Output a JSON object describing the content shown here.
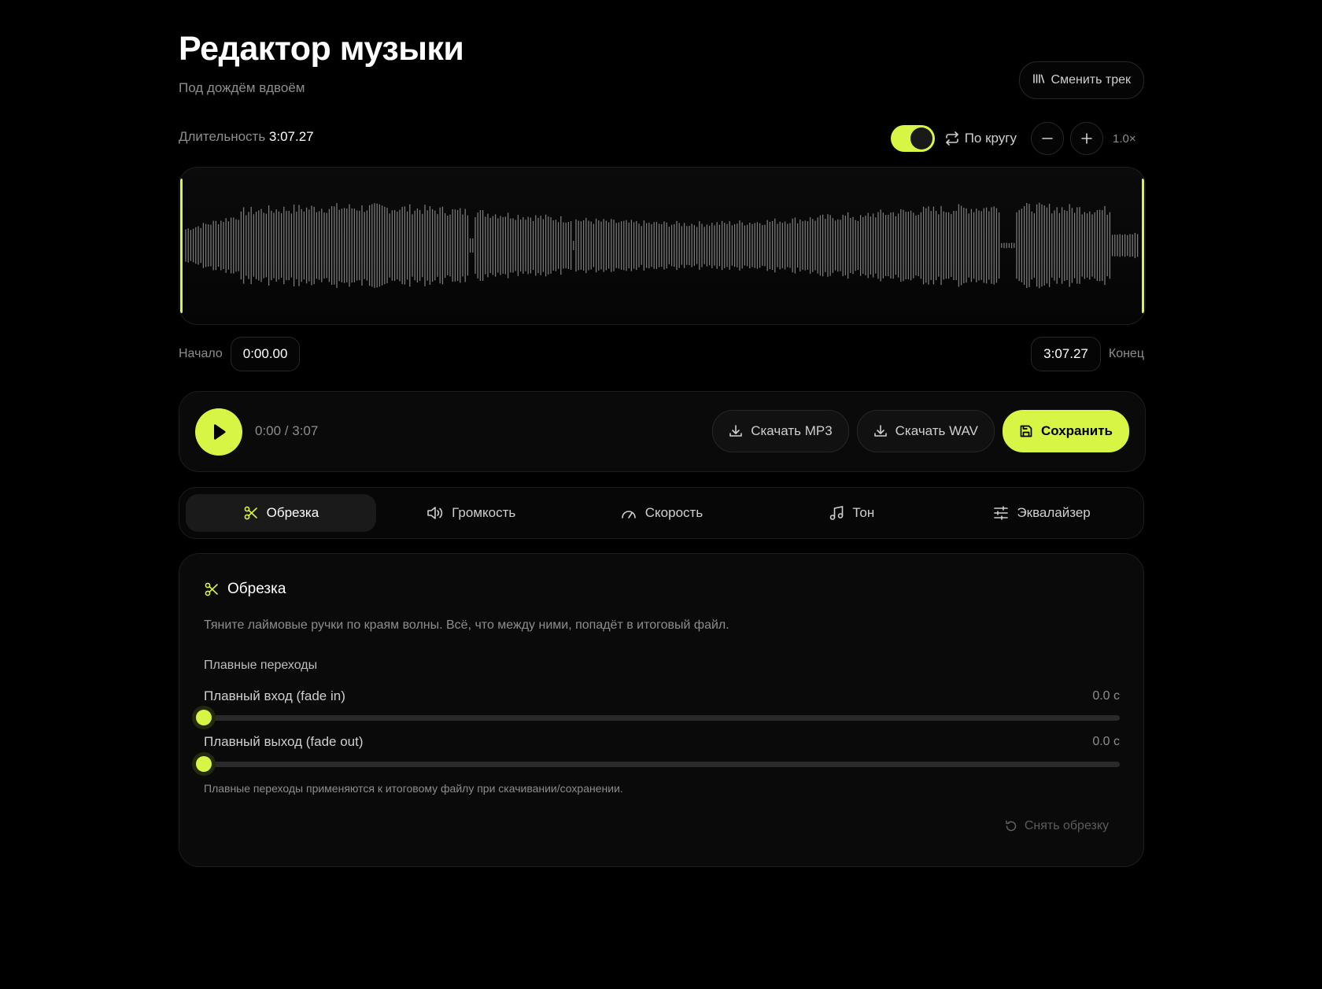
{
  "header": {
    "title": "Редактор музыки",
    "subtitle": "Под дождём вдвоём",
    "switch_track_label": "Сменить трек"
  },
  "meta": {
    "duration_label": "Длительность",
    "duration_value": "3:07.27"
  },
  "loop": {
    "enabled": true,
    "label": "По кругу"
  },
  "zoom": {
    "out_symbol": "−",
    "in_symbol": "+",
    "level": "1.0×"
  },
  "waveform": {
    "trim_start_fraction": 0,
    "trim_end_fraction": 1
  },
  "trim": {
    "start_label": "Начало",
    "start_value": "0:00.00",
    "end_value": "3:07.27",
    "end_label": "Конец"
  },
  "player": {
    "progress": "0:00 / 3:07",
    "download_mp3": "Скачать MP3",
    "download_wav": "Скачать WAV",
    "save": "Сохранить"
  },
  "tabs": [
    {
      "label": "Обрезка",
      "icon": "scissors-icon",
      "active": true
    },
    {
      "label": "Громкость",
      "icon": "volume-icon",
      "active": false
    },
    {
      "label": "Скорость",
      "icon": "speedometer-icon",
      "active": false
    },
    {
      "label": "Тон",
      "icon": "music-note-icon",
      "active": false
    },
    {
      "label": "Эквалайзер",
      "icon": "equalizer-icon",
      "active": false
    }
  ],
  "panel": {
    "title": "Обрезка",
    "description": "Тяните лаймовые ручки по краям волны. Всё, что между ними, попадёт в итоговый файл.",
    "section_label": "Плавные переходы",
    "fade_in": {
      "label": "Плавный вход (fade in)",
      "value": "0.0 с",
      "fraction": 0
    },
    "fade_out": {
      "label": "Плавный выход (fade out)",
      "value": "0.0 с",
      "fraction": 0
    },
    "note": "Плавные переходы применяются к итоговому файлу при скачивании/сохранении.",
    "reset_label": "Снять обрезку"
  },
  "colors": {
    "accent": "#d6f544",
    "background": "#000000",
    "surface": "#0a0a0a",
    "wave": "#7a7a7a"
  }
}
